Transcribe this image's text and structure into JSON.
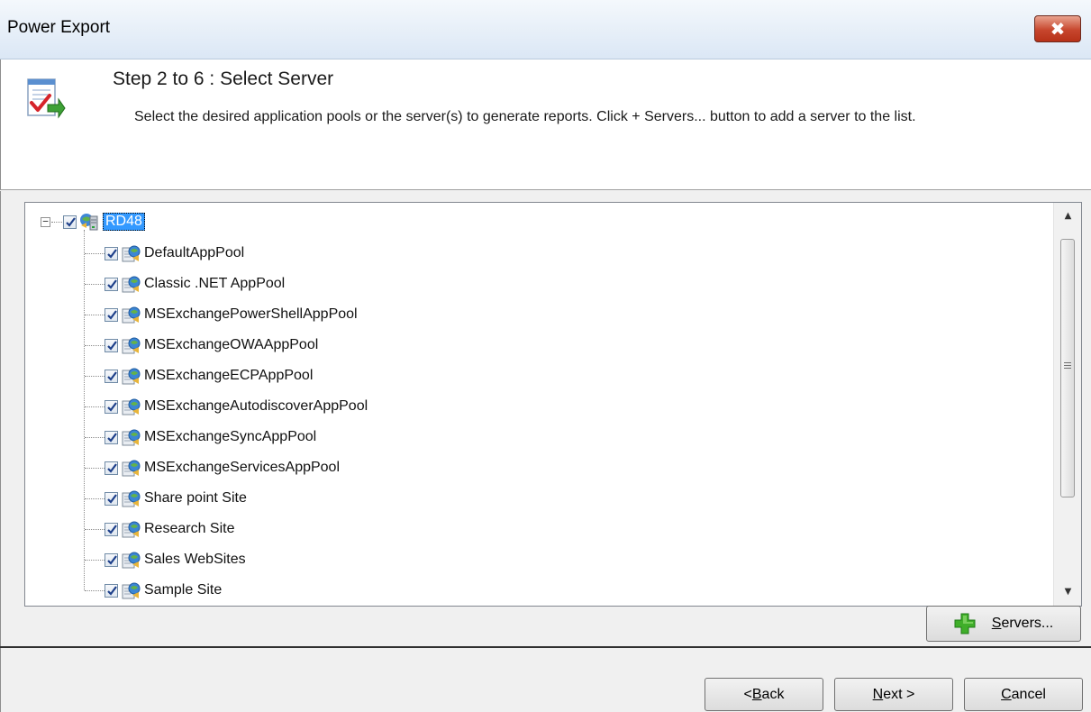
{
  "window": {
    "title": "Power Export",
    "close_glyph": "✖"
  },
  "header": {
    "step_title": "Step 2 to 6 : Select Server",
    "description": "Select the desired application pools or the server(s) to generate reports. Click + Servers... button to add a server to the list."
  },
  "tree": {
    "root": {
      "label": "RD48",
      "checked": true,
      "icon": "server-icon"
    },
    "children": [
      {
        "label": "DefaultAppPool",
        "checked": true,
        "icon": "app-pool-icon"
      },
      {
        "label": "Classic .NET AppPool",
        "checked": true,
        "icon": "app-pool-icon"
      },
      {
        "label": "MSExchangePowerShellAppPool",
        "checked": true,
        "icon": "app-pool-icon"
      },
      {
        "label": "MSExchangeOWAAppPool",
        "checked": true,
        "icon": "app-pool-icon"
      },
      {
        "label": "MSExchangeECPAppPool",
        "checked": true,
        "icon": "app-pool-icon"
      },
      {
        "label": "MSExchangeAutodiscoverAppPool",
        "checked": true,
        "icon": "app-pool-icon"
      },
      {
        "label": "MSExchangeSyncAppPool",
        "checked": true,
        "icon": "app-pool-icon"
      },
      {
        "label": "MSExchangeServicesAppPool",
        "checked": true,
        "icon": "app-pool-icon"
      },
      {
        "label": "Share point Site",
        "checked": true,
        "icon": "app-pool-icon"
      },
      {
        "label": "Research Site",
        "checked": true,
        "icon": "app-pool-icon"
      },
      {
        "label": "Sales WebSites",
        "checked": true,
        "icon": "app-pool-icon"
      },
      {
        "label": "Sample Site",
        "checked": true,
        "icon": "app-pool-icon"
      }
    ]
  },
  "buttons": {
    "servers": {
      "label_first": "S",
      "label_rest": "ervers..."
    },
    "back": {
      "label_pre": "<",
      "label_first": "B",
      "label_rest": "ack"
    },
    "next": {
      "label_first": "N",
      "label_rest": "ext >"
    },
    "cancel": {
      "label_first": "C",
      "label_rest": "ancel"
    }
  },
  "colors": {
    "selection": "#3399ff",
    "close_button": "#c7462d",
    "add_icon": "#3fae29"
  }
}
